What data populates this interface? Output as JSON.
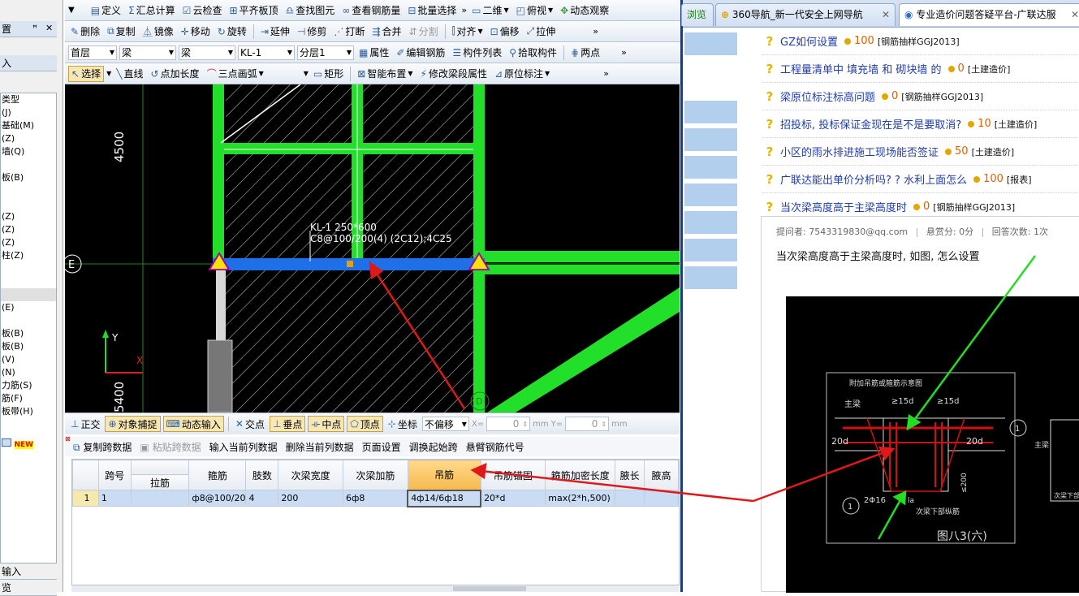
{
  "left_panel": {
    "header1": "置",
    "header2": "入",
    "tree": [
      "类型",
      "(J)",
      "基础(M)",
      "(Z)",
      "墙(Q)",
      "",
      "板(B)",
      "",
      "",
      "(Z)",
      "(Z)",
      "(Z)",
      "柱(Z)",
      "",
      "",
      "",
      "(E)",
      "",
      "板(B)",
      "板(B)",
      "(V)",
      "(N)",
      "力筋(S)",
      "筋(F)",
      "板带(H)"
    ],
    "new_badge": "NEW",
    "footer1": "输入",
    "footer2": "览"
  },
  "toolbar1": {
    "items": [
      "定义",
      "汇总计算",
      "云检查",
      "平齐板顶",
      "查找图元",
      "查看钢筋量",
      "批量选择",
      "二维",
      "俯视",
      "动态观察"
    ],
    "more": "»"
  },
  "toolbar2": {
    "items": [
      "删除",
      "复制",
      "镜像",
      "移动",
      "旋转",
      "延伸",
      "修剪",
      "打断",
      "合并",
      "分割",
      "对齐",
      "偏移",
      "拉伸"
    ]
  },
  "toolbar3": {
    "floor": "首层",
    "type1": "梁",
    "type2": "梁",
    "component": "KL-1",
    "layer": "分层1",
    "items": [
      "属性",
      "编辑钢筋",
      "构件列表",
      "拾取构件",
      "两点"
    ]
  },
  "toolbar4": {
    "items": [
      "选择",
      "直线",
      "点加长度",
      "三点画弧",
      "矩形",
      "智能布置",
      "修改梁段属性",
      "原位标注"
    ]
  },
  "canvas": {
    "dim_top": "4500",
    "dim_bottom": "5400",
    "axis_e": "E",
    "axis_y": "Y",
    "axis_x": "X",
    "beam_label_1": "KL-1 250*600",
    "beam_label_2": "C8@100/200(4) (2C12);4C25",
    "axis_bottom": "D"
  },
  "snapbar": {
    "items": [
      "正交",
      "对象捕捉",
      "动态输入",
      "交点",
      "垂点",
      "中点",
      "顶点",
      "坐标"
    ],
    "offset_mode": "不偏移",
    "x_label": "X=",
    "x_value": "0",
    "y_label": "Y=",
    "y_value": "0",
    "unit": "mm"
  },
  "grid_toolbar": {
    "items": [
      "复制跨数据",
      "粘贴跨数据",
      "输入当前列数据",
      "删除当前列数据",
      "页面设置",
      "调换起始跨",
      "悬臂钢筋代号"
    ]
  },
  "grid": {
    "headers": [
      "跨号",
      "拉筋",
      "箍筋",
      "肢数",
      "次梁宽度",
      "次梁加筋",
      "吊筋",
      "吊筋锚固",
      "箍筋加密长度",
      "腋长",
      "腋高"
    ],
    "row": [
      "1",
      "1",
      "",
      "ф8@100/20",
      "4",
      "200",
      "6ф8",
      "4ф14/6ф18",
      "20*d",
      "max(2*h,500)",
      "",
      ""
    ]
  },
  "browser": {
    "tab_partial": "浏览",
    "tab1": "360导航_新一代安全上网导航",
    "tab2": "专业造价问题答疑平台-广联达服",
    "questions": [
      {
        "title": "GZ如何设置",
        "points": "100",
        "cat": "[钢筋抽样GGJ2013]"
      },
      {
        "title": "工程量清单中 填充墙 和 砌块墙 的",
        "points": "0",
        "cat": "[土建造价]"
      },
      {
        "title": "梁原位标注标高问题",
        "points": "0",
        "cat": "[钢筋抽样GGJ2013]"
      },
      {
        "title": "招投标, 投标保证金现在是不是要取消?",
        "points": "10",
        "cat": "[土建造价]"
      },
      {
        "title": "小区的雨水排进施工现场能否签证",
        "points": "50",
        "cat": "[土建造价]"
      },
      {
        "title": "广联达能出单价分析吗? ? 水利上面怎么",
        "points": "100",
        "cat": "[报表]"
      },
      {
        "title": "当次梁高度高于主梁高度时",
        "points": "0",
        "cat": "[钢筋抽样GGJ2013]"
      }
    ],
    "meta_asker": "提问者: 7543319830@qq.com",
    "meta_reward": "悬赏分: 0分",
    "meta_answers": "回答次数: 1次",
    "question_text": "当次梁高度高于主梁高度时, 如图, 怎么设置",
    "cad": {
      "title": "附加吊筋或箍筋示意图",
      "main_beam": "主梁",
      "d15a": "≥15d",
      "d15b": "≥15d",
      "d20a": "20d",
      "d20b": "20d",
      "bars": "2Φ16",
      "dim200": "≤200",
      "secondary": "次梁下部纵筋",
      "fig": "图八3(六)",
      "circle": "1",
      "la": "la",
      "right_label": "主梁",
      "right_label2": "次梁下部"
    }
  },
  "colors": {
    "beam_green": "#22e02a",
    "beam_blue": "#1f6fe8",
    "arrow_red": "#e01818",
    "arrow_green": "#22dd22",
    "cad_red": "#d21010",
    "tab_active": "#ffffff"
  }
}
